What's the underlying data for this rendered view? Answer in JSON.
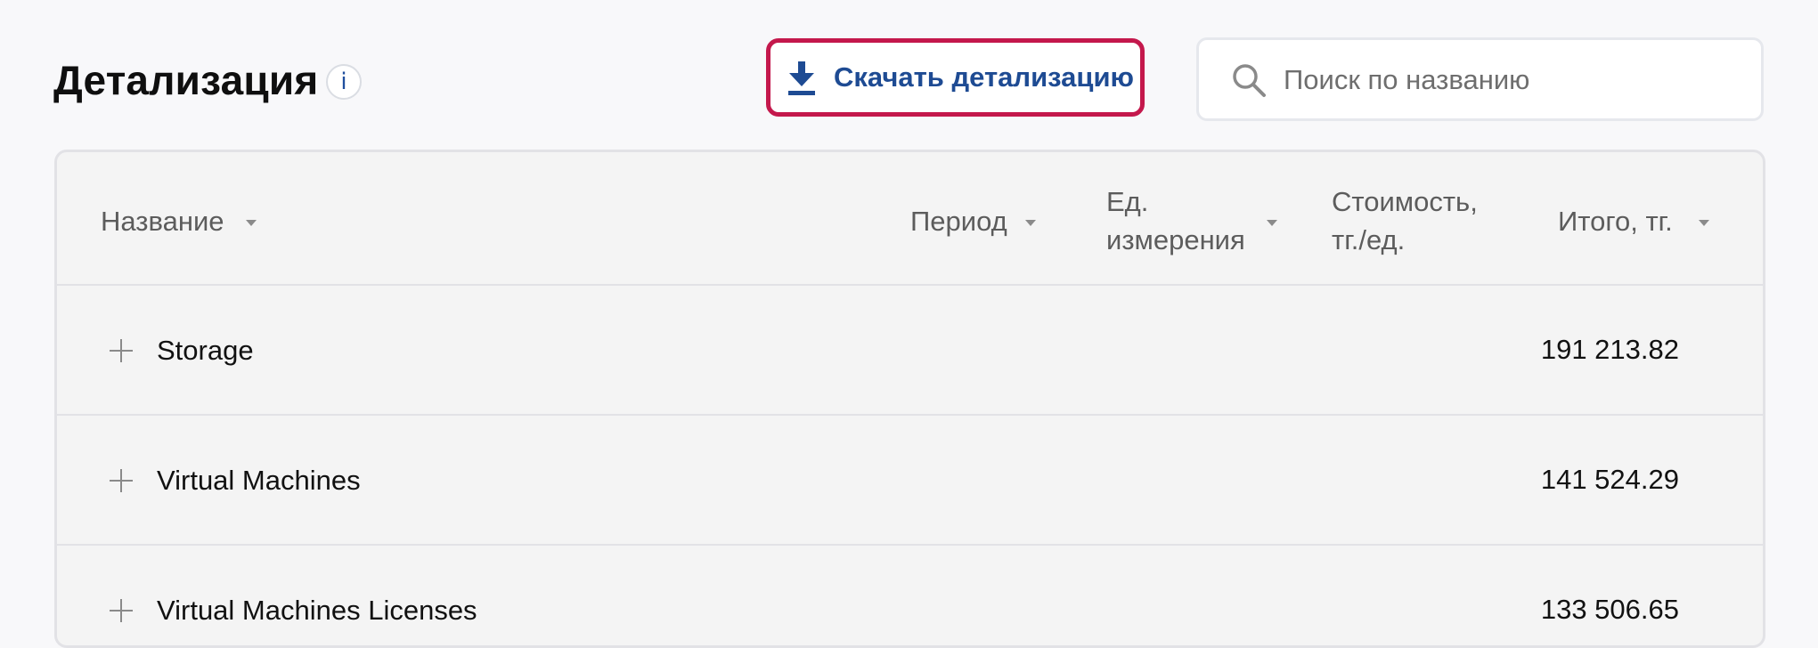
{
  "header": {
    "title": "Детализация",
    "info_icon": "info-icon",
    "info_label": "i"
  },
  "download": {
    "label": "Скачать детализацию",
    "icon": "download-icon",
    "accent_color": "#c4184c",
    "text_color": "#1e4b93"
  },
  "search": {
    "placeholder": "Поиск по названию",
    "value": "",
    "icon": "search-icon"
  },
  "table": {
    "columns": [
      {
        "label": "Название",
        "sortable": true
      },
      {
        "label": "Период",
        "sortable": true
      },
      {
        "label": "Ед. измерения",
        "line1": "Ед.",
        "line2": "измерения",
        "sortable": true
      },
      {
        "label": "Стоимость, тг./ед.",
        "line1": "Стоимость,",
        "line2": "тг./ед.",
        "sortable": false
      },
      {
        "label": "Итого, тг.",
        "sortable": true
      }
    ],
    "rows": [
      {
        "name": "Storage",
        "period": "",
        "unit": "",
        "cost": "",
        "total": "191 213.82",
        "expand_icon": "plus-icon"
      },
      {
        "name": "Virtual Machines",
        "period": "",
        "unit": "",
        "cost": "",
        "total": "141 524.29",
        "expand_icon": "plus-icon"
      },
      {
        "name": "Virtual Machines Licenses",
        "period": "",
        "unit": "",
        "cost": "",
        "total": "133 506.65",
        "expand_icon": "plus-icon"
      }
    ]
  }
}
